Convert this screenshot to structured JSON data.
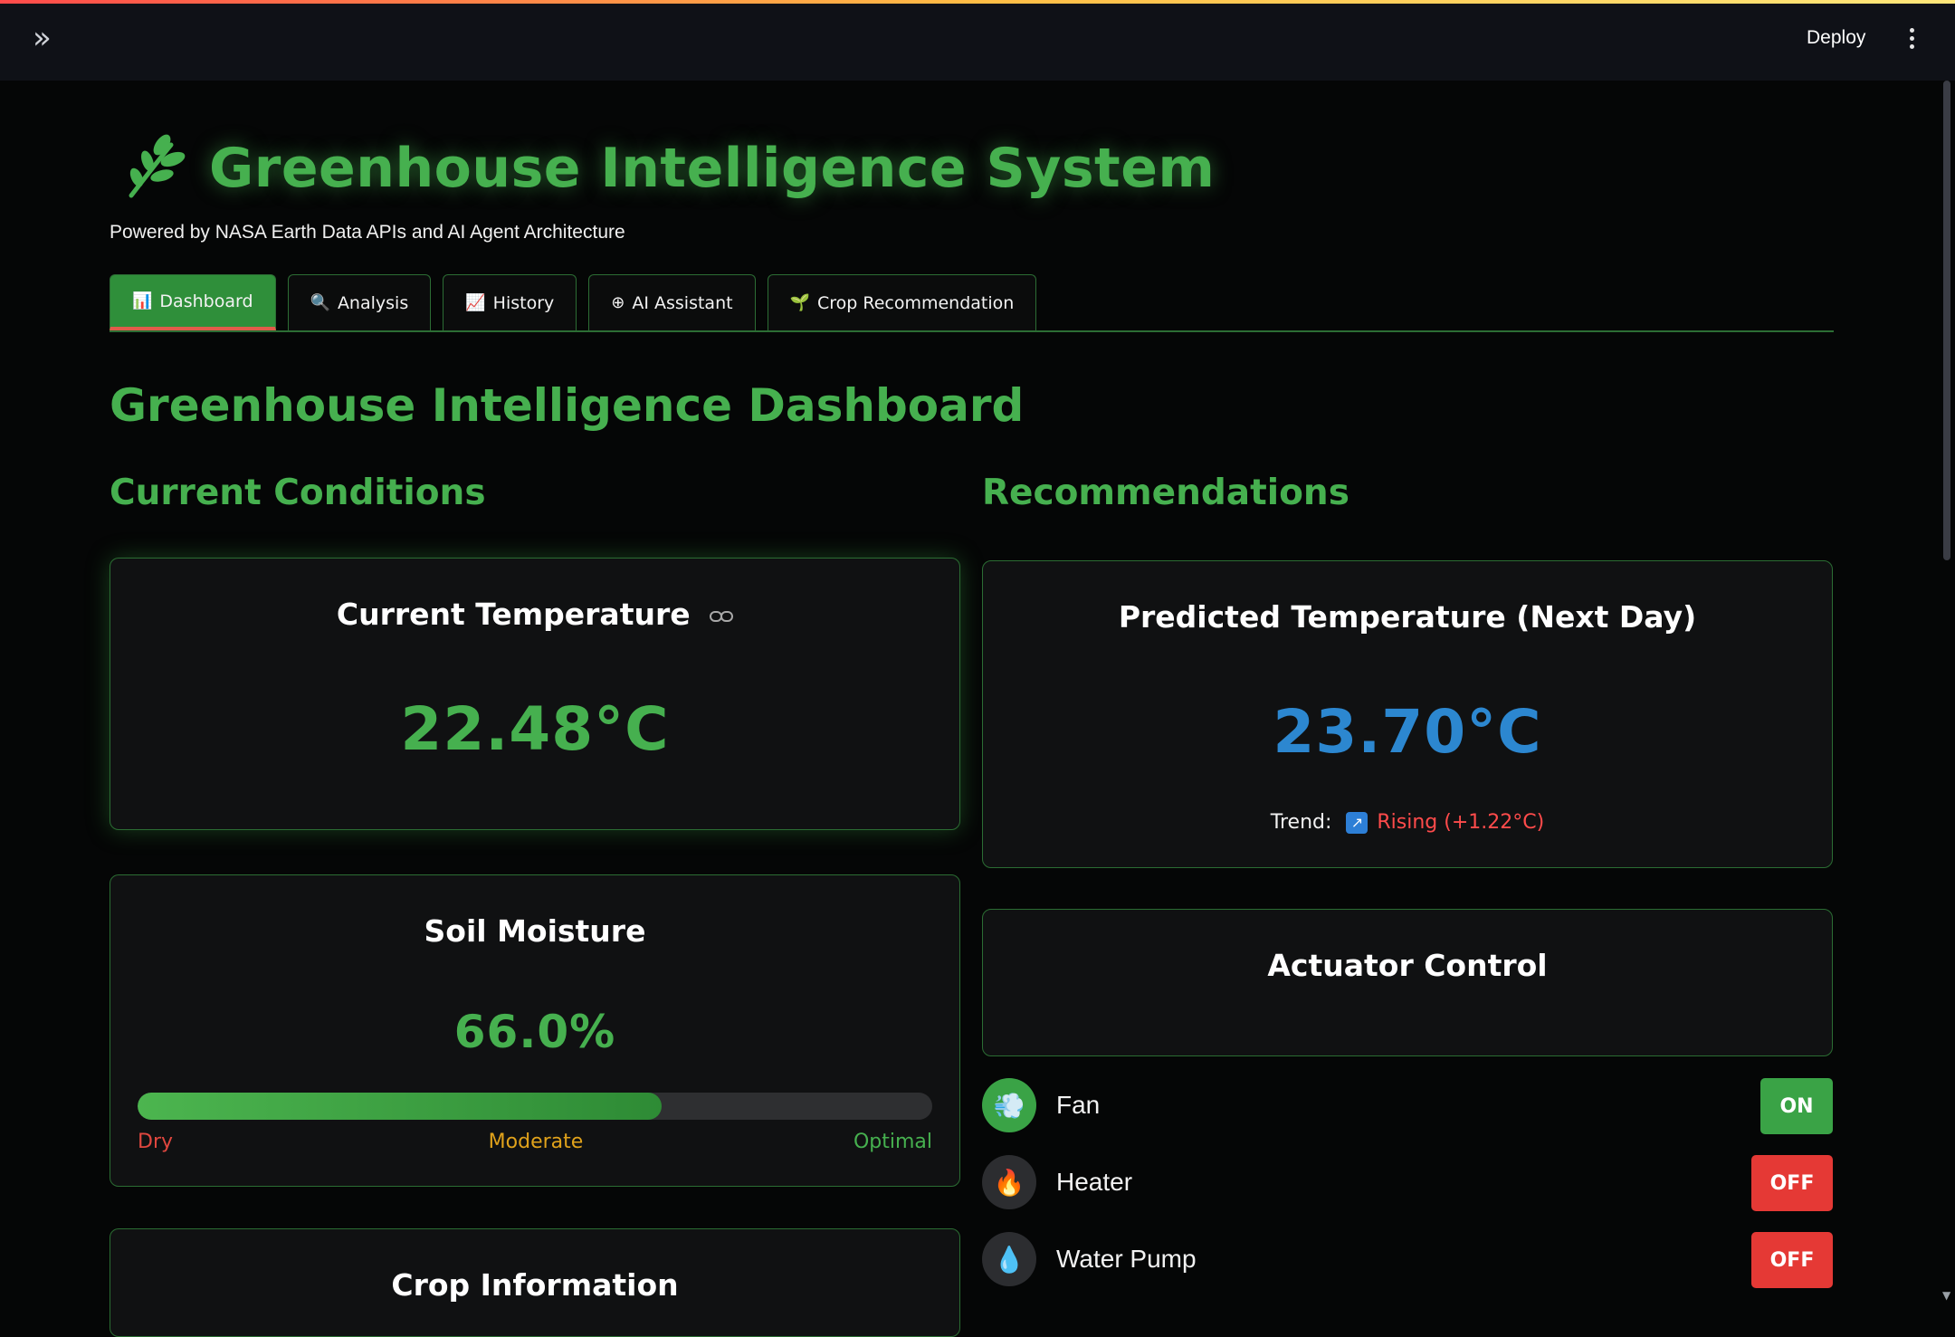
{
  "header": {
    "deploy_label": "Deploy"
  },
  "app": {
    "title": "Greenhouse Intelligence System",
    "subtitle": "Powered by NASA Earth Data APIs and AI Agent Architecture"
  },
  "tabs": [
    {
      "label": "Dashboard",
      "icon": "📊",
      "active": true
    },
    {
      "label": "Analysis",
      "icon": "🔍",
      "active": false
    },
    {
      "label": "History",
      "icon": "📈",
      "active": false
    },
    {
      "label": "AI Assistant",
      "icon": "⊕",
      "active": false
    },
    {
      "label": "Crop Recommendation",
      "icon": "🌱",
      "active": false
    }
  ],
  "dashboard": {
    "heading": "Greenhouse Intelligence Dashboard",
    "current_conditions_heading": "Current Conditions",
    "recommendations_heading": "Recommendations"
  },
  "current_temperature": {
    "title": "Current Temperature",
    "value": "22.48°C"
  },
  "soil_moisture": {
    "title": "Soil Moisture",
    "value": "66.0%",
    "percent": 66.0,
    "scale": {
      "dry": "Dry",
      "moderate": "Moderate",
      "optimal": "Optimal"
    }
  },
  "crop_information": {
    "title": "Crop Information"
  },
  "predicted_temperature": {
    "title": "Predicted Temperature (Next Day)",
    "value": "23.70°C",
    "trend_label": "Trend:",
    "trend_icon": "↗",
    "trend_text": "Rising (+1.22°C)"
  },
  "actuator_control": {
    "title": "Actuator Control",
    "items": [
      {
        "name": "Fan",
        "icon": "💨",
        "state": "ON"
      },
      {
        "name": "Heater",
        "icon": "🔥",
        "state": "OFF"
      },
      {
        "name": "Water Pump",
        "icon": "💧",
        "state": "OFF"
      }
    ]
  },
  "colors": {
    "accent_green": "#46b04f",
    "predicted_blue": "#2c87d0",
    "rising_red": "#ff4b4b",
    "moderate_orange": "#e0a21b",
    "on_green": "#3aa346",
    "off_red": "#e53935"
  }
}
